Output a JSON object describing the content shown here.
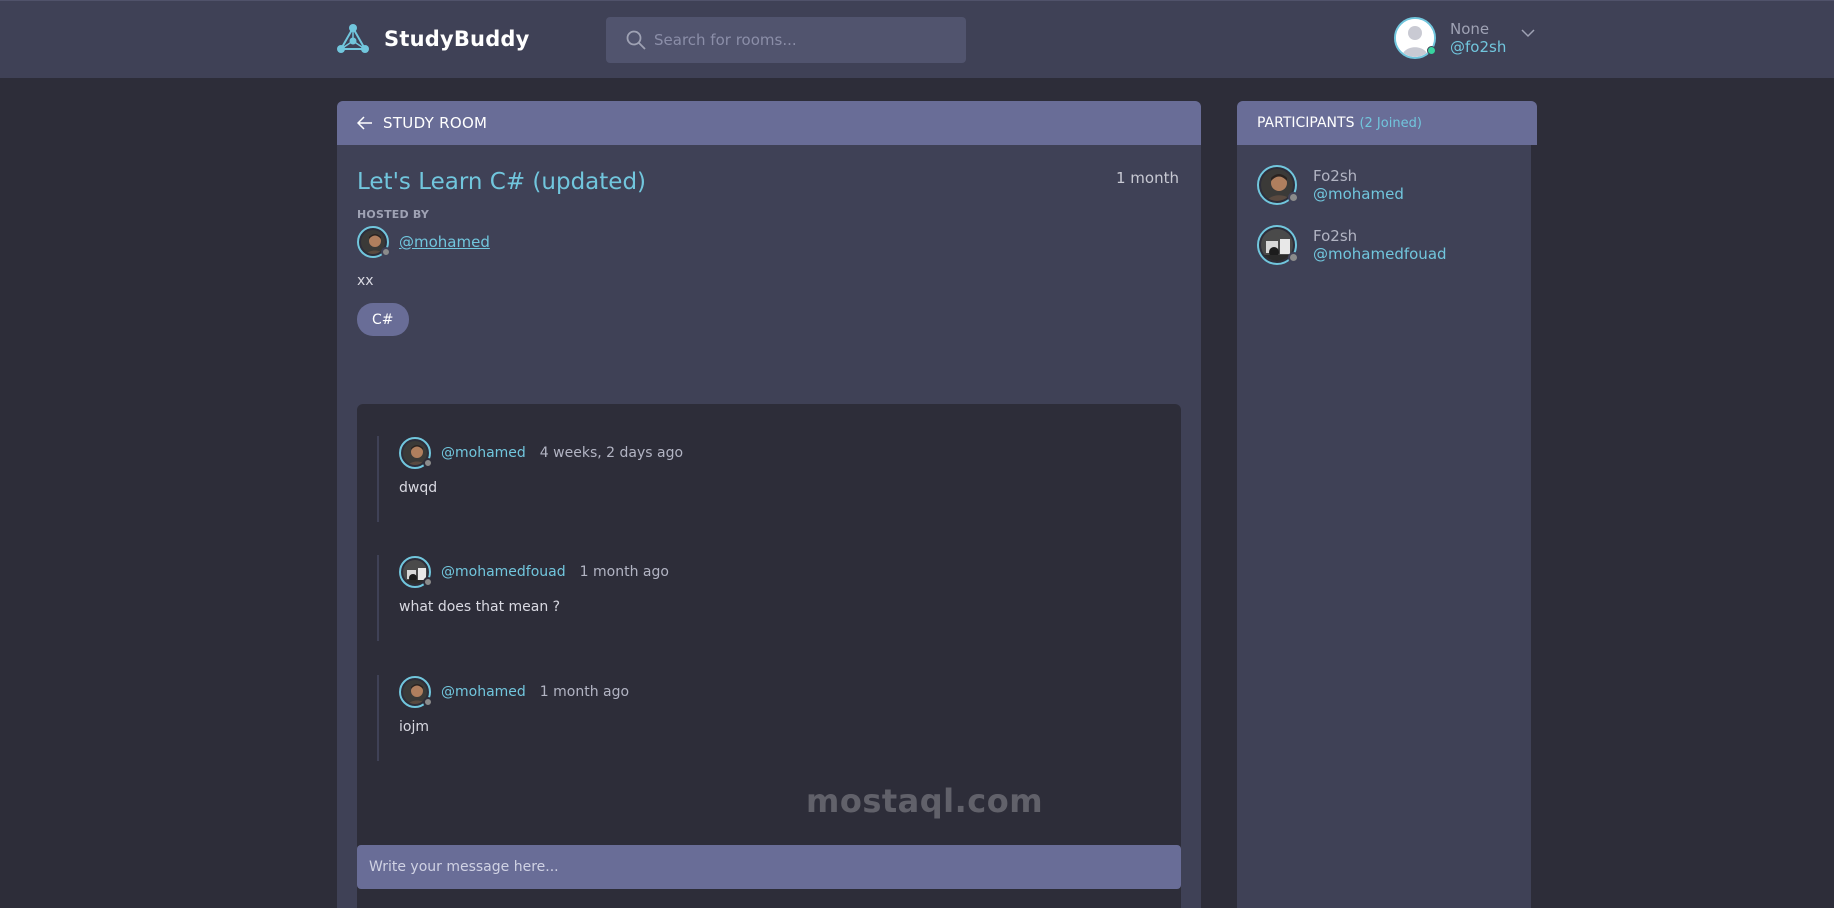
{
  "brand": {
    "name": "StudyBuddy"
  },
  "search": {
    "placeholder": "Search for rooms..."
  },
  "user": {
    "name": "None",
    "handle": "@fo2sh"
  },
  "room": {
    "header": "STUDY ROOM",
    "title": "Let's Learn C# (updated)",
    "time": "1 month",
    "hosted_label": "HOSTED BY",
    "host": "@mohamed",
    "description": "xx",
    "topic": "C#"
  },
  "messages": [
    {
      "user": "@mohamed",
      "time": "4 weeks, 2 days ago",
      "text": "dwqd"
    },
    {
      "user": "@mohamedfouad",
      "time": "1 month ago",
      "text": "what does that mean ?"
    },
    {
      "user": "@mohamed",
      "time": "1 month ago",
      "text": "iojm"
    }
  ],
  "composer": {
    "placeholder": "Write your message here..."
  },
  "participants": {
    "title": "PARTICIPANTS",
    "count": "(2 Joined)",
    "items": [
      {
        "name": "Fo2sh",
        "handle": "@mohamed"
      },
      {
        "name": "Fo2sh",
        "handle": "@mohamedfouad"
      }
    ]
  },
  "watermark": {
    "text": "mostaql.com"
  },
  "colors": {
    "accent": "#71c6dd",
    "panel": "#3f4156",
    "header": "#696d97",
    "background": "#2d2d39"
  }
}
